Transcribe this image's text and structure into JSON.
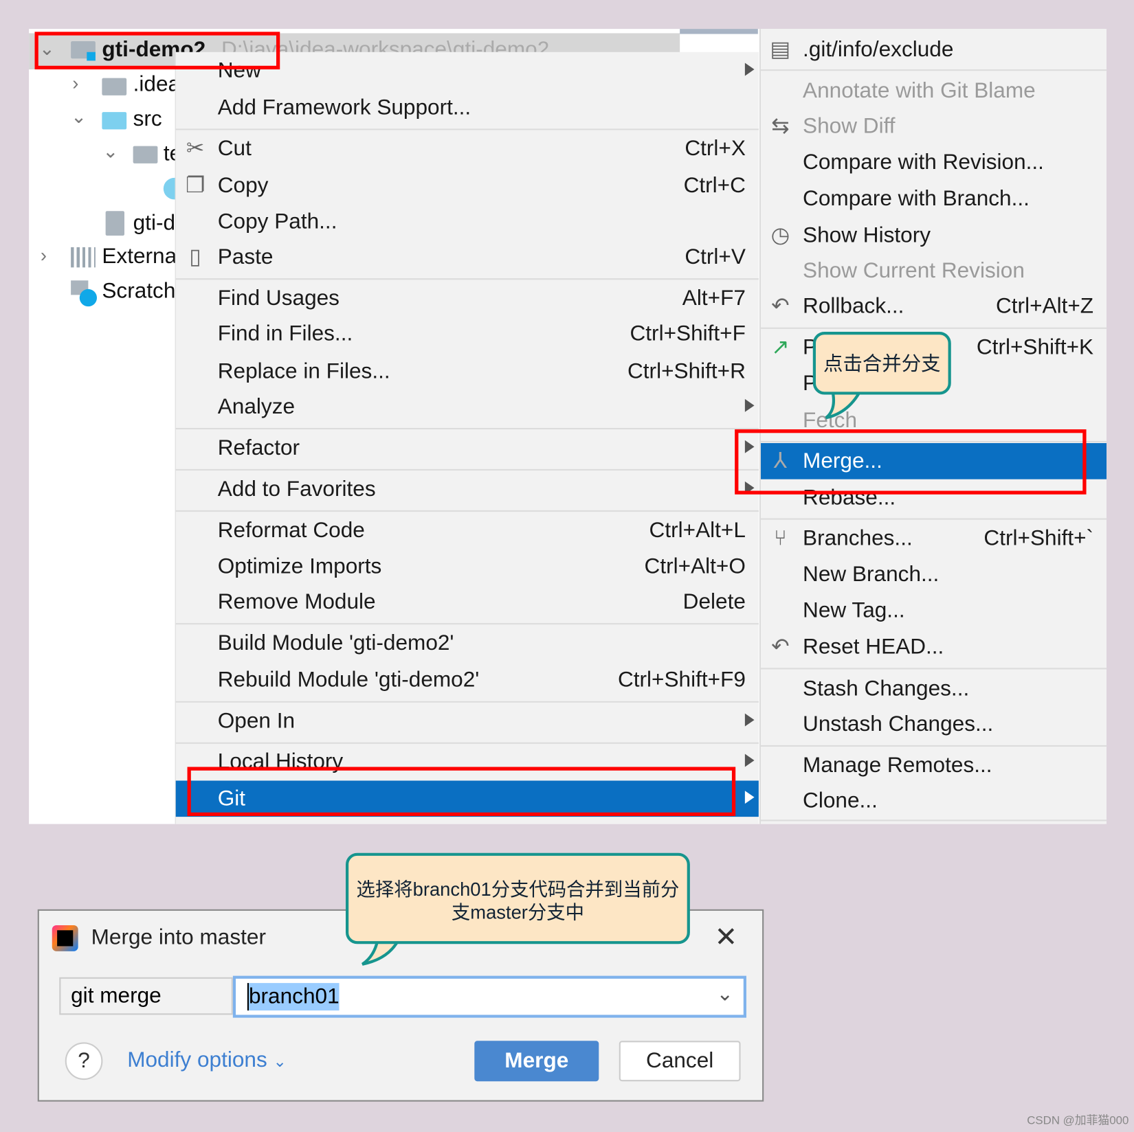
{
  "tree": {
    "root": {
      "name": "gti-demo2",
      "path": "D:\\java\\idea-workspace\\gti-demo2"
    },
    "items": [
      ".idea",
      "src",
      "te",
      "gti-d",
      "External",
      "Scratch"
    ]
  },
  "context_menu": {
    "items": [
      {
        "label": "New",
        "submenu": true
      },
      {
        "label": "Add Framework Support..."
      },
      {
        "label": "Cut",
        "shortcut": "Ctrl+X",
        "icon": "scissors-icon"
      },
      {
        "label": "Copy",
        "shortcut": "Ctrl+C",
        "icon": "copy-icon"
      },
      {
        "label": "Copy Path..."
      },
      {
        "label": "Paste",
        "shortcut": "Ctrl+V",
        "icon": "clipboard-icon"
      },
      {
        "label": "Find Usages",
        "shortcut": "Alt+F7"
      },
      {
        "label": "Find in Files...",
        "shortcut": "Ctrl+Shift+F"
      },
      {
        "label": "Replace in Files...",
        "shortcut": "Ctrl+Shift+R"
      },
      {
        "label": "Analyze",
        "submenu": true
      },
      {
        "label": "Refactor",
        "submenu": true
      },
      {
        "label": "Add to Favorites",
        "submenu": true
      },
      {
        "label": "Reformat Code",
        "shortcut": "Ctrl+Alt+L"
      },
      {
        "label": "Optimize Imports",
        "shortcut": "Ctrl+Alt+O"
      },
      {
        "label": "Remove Module",
        "shortcut": "Delete"
      },
      {
        "label": "Build Module 'gti-demo2'"
      },
      {
        "label": "Rebuild Module 'gti-demo2'",
        "shortcut": "Ctrl+Shift+F9"
      },
      {
        "label": "Open In",
        "submenu": true
      },
      {
        "label": "Local History",
        "submenu": true
      },
      {
        "label": "Git",
        "submenu": true,
        "selected": true
      }
    ]
  },
  "git_submenu": {
    "items": [
      {
        "label": ".git/info/exclude",
        "icon": "ignore-file-icon"
      },
      {
        "label": "Annotate with Git Blame",
        "disabled": true
      },
      {
        "label": "Show Diff",
        "disabled": true,
        "icon": "diff-icon"
      },
      {
        "label": "Compare with Revision..."
      },
      {
        "label": "Compare with Branch..."
      },
      {
        "label": "Show History",
        "icon": "clock-icon"
      },
      {
        "label": "Show Current Revision",
        "disabled": true
      },
      {
        "label": "Rollback...",
        "shortcut": "Ctrl+Alt+Z",
        "icon": "rollback-icon"
      },
      {
        "label": "P",
        "shortcut": "Ctrl+Shift+K",
        "icon": "push-icon"
      },
      {
        "label": "P"
      },
      {
        "label": "Fetch",
        "disabled": true
      },
      {
        "label": "Merge...",
        "selected": true,
        "icon": "merge-icon"
      },
      {
        "label": "Rebase..."
      },
      {
        "label": "Branches...",
        "shortcut": "Ctrl+Shift+`",
        "icon": "branch-icon"
      },
      {
        "label": "New Branch..."
      },
      {
        "label": "New Tag..."
      },
      {
        "label": "Reset HEAD...",
        "icon": "rollback-icon"
      },
      {
        "label": "Stash Changes..."
      },
      {
        "label": "Unstash Changes..."
      },
      {
        "label": "Manage Remotes..."
      },
      {
        "label": "Clone..."
      }
    ]
  },
  "callouts": {
    "merge_hint": "点击合并分支",
    "dialog_hint": "选择将branch01分支代码合并到当前分支master分支中"
  },
  "dialog": {
    "title": "Merge into master",
    "command_label": "git merge",
    "branch_value": "branch01",
    "modify_options": "Modify options",
    "help": "?",
    "merge_button": "Merge",
    "cancel_button": "Cancel"
  },
  "watermark": "CSDN @加菲猫000",
  "colors": {
    "selection": "#0a6fc2",
    "highlight_box": "#ff0000",
    "callout_bg": "#fde6c5",
    "callout_border": "#16958e",
    "link": "#3d7fd1",
    "primary_button": "#4a88d0"
  }
}
